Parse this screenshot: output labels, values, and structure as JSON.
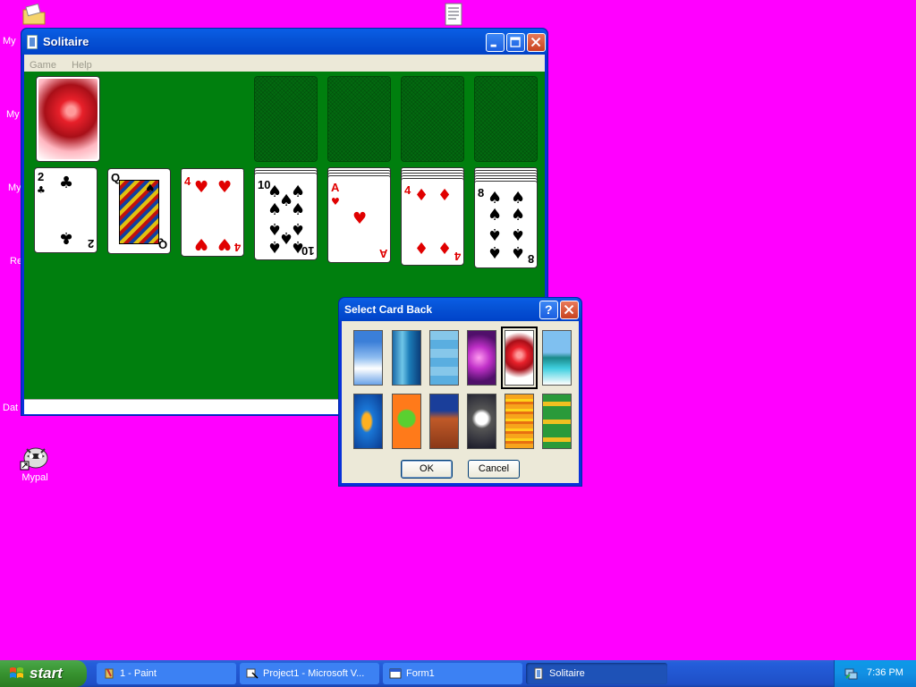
{
  "desktop": {
    "icons": [
      {
        "label": "My",
        "name": "my-documents-icon"
      },
      {
        "label": "My",
        "name": "my-computer-icon"
      },
      {
        "label": "My",
        "name": "my-network-icon"
      },
      {
        "label": "Re",
        "name": "recycle-bin-icon"
      },
      {
        "label": "Dat",
        "name": "data-icon"
      },
      {
        "label": "Mypal",
        "name": "mypal-icon"
      }
    ]
  },
  "window": {
    "title": "Solitaire",
    "menu": [
      "Game",
      "Help"
    ],
    "tableau": [
      {
        "cards": [
          {
            "rank": "2",
            "suit": "♣",
            "color": "black"
          }
        ],
        "stacked": 0
      },
      {
        "cards": [
          {
            "rank": "Q",
            "suit": "♠",
            "color": "black"
          }
        ],
        "stacked": 0
      },
      {
        "cards": [
          {
            "rank": "4",
            "suit": "♥",
            "color": "red"
          }
        ],
        "stacked": 1
      },
      {
        "cards": [
          {
            "rank": "10",
            "suit": "♠",
            "color": "black"
          }
        ],
        "stacked": 3
      },
      {
        "cards": [
          {
            "rank": "A",
            "suit": "♥",
            "color": "red"
          }
        ],
        "stacked": 4
      },
      {
        "cards": [
          {
            "rank": "4",
            "suit": "♦",
            "color": "red"
          }
        ],
        "stacked": 5
      },
      {
        "cards": [
          {
            "rank": "8",
            "suit": "♠",
            "color": "black"
          }
        ],
        "stacked": 6
      }
    ]
  },
  "dialog": {
    "title": "Select Card Back",
    "help_symbol": "?",
    "ok_label": "OK",
    "cancel_label": "Cancel",
    "selected_back": 4,
    "backs": [
      {
        "name": "sky-clouds"
      },
      {
        "name": "blue-glass"
      },
      {
        "name": "blue-tiles"
      },
      {
        "name": "purple-lights"
      },
      {
        "name": "red-sphere"
      },
      {
        "name": "beach-palms"
      },
      {
        "name": "tropical-fish"
      },
      {
        "name": "frog"
      },
      {
        "name": "desert-dunes"
      },
      {
        "name": "astronaut"
      },
      {
        "name": "orange-stripes"
      },
      {
        "name": "cars"
      }
    ]
  },
  "taskbar": {
    "start_label": "start",
    "tasks": [
      {
        "label": "1 - Paint",
        "active": false
      },
      {
        "label": "Project1 - Microsoft V...",
        "active": false
      },
      {
        "label": "Form1",
        "active": false
      },
      {
        "label": "Solitaire",
        "active": true
      }
    ],
    "clock": "7:36 PM"
  }
}
